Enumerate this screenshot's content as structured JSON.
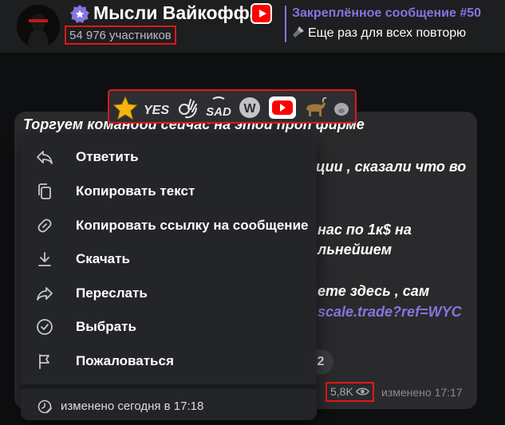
{
  "header": {
    "channel_title": "Мысли Вайкоффа",
    "subscribers": "54 976 участников",
    "pinned_title": "Закреплённое сообщение #50",
    "pinned_text": "Еще раз для всех повторю"
  },
  "reactions": [
    "star-emoji",
    "yes-sticker",
    "ok-hand-emoji",
    "sad-sticker",
    "w-logo",
    "youtube-logo",
    "goat-emoji"
  ],
  "message": {
    "line1": "Торгуем командой сейчас на этой проп фирме",
    "line2": "ции , сказали что во",
    "line3": "нас по 1к$ на",
    "line4": "льнейшем",
    "line5": "ете здесь , сам",
    "link": "scale.trade?ref=WYC",
    "reaction_count": "2",
    "views": "5,8K",
    "edited": "изменено 17:17"
  },
  "context_menu": {
    "items": [
      {
        "label": "Ответить",
        "icon": "reply-icon"
      },
      {
        "label": "Копировать текст",
        "icon": "copy-icon"
      },
      {
        "label": "Копировать ссылку на сообщение",
        "icon": "link-icon"
      },
      {
        "label": "Скачать",
        "icon": "download-icon"
      },
      {
        "label": "Переслать",
        "icon": "forward-icon"
      },
      {
        "label": "Выбрать",
        "icon": "check-circle-icon"
      },
      {
        "label": "Пожаловаться",
        "icon": "flag-icon"
      }
    ],
    "edited_info": "изменено сегодня в 17:18"
  },
  "colors": {
    "accent": "#8774e1",
    "highlight_box": "#e01818",
    "header_bg": "#1d1e20",
    "menu_bg": "#242528"
  }
}
